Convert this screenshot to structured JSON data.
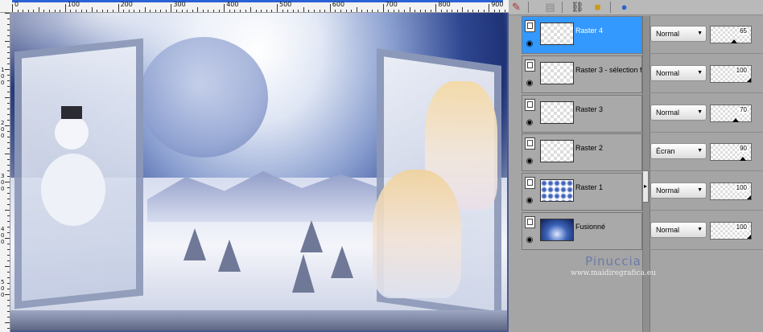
{
  "ruler": {
    "top_labels": [
      "0",
      "100",
      "200",
      "300",
      "400",
      "500",
      "600",
      "700",
      "800",
      "900"
    ],
    "left_labels": [
      "1",
      "0",
      "0",
      "2",
      "0",
      "0",
      "3",
      "0",
      "0",
      "4",
      "0",
      "0",
      "5",
      "0",
      "0"
    ]
  },
  "toolbar": {
    "icons": [
      "paint-brush-icon",
      "document-icon",
      "link-icon",
      "lock-icon",
      "sphere-icon"
    ]
  },
  "layers": [
    {
      "name": "Raster 4",
      "selected": true,
      "blend": "Normal",
      "opacity": "65"
    },
    {
      "name": "Raster 3 - sélection f",
      "selected": false,
      "blend": "Normal",
      "opacity": "100"
    },
    {
      "name": "Raster 3",
      "selected": false,
      "blend": "Normal",
      "opacity": "70"
    },
    {
      "name": "Raster 2",
      "selected": false,
      "blend": "Écran",
      "opacity": "90"
    },
    {
      "name": "Raster 1",
      "selected": false,
      "blend": "Normal",
      "opacity": "100"
    },
    {
      "name": "Fusionné",
      "selected": false,
      "blend": "Normal",
      "opacity": "100"
    }
  ],
  "watermark": {
    "name": "Pinuccia",
    "url": "www.maidiregrafica.eu"
  },
  "colors": {
    "selection": "#3399ff",
    "panel": "#a5a5a5",
    "ruler_selection": "#2b62d8"
  }
}
